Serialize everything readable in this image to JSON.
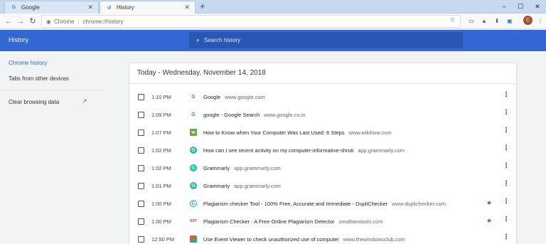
{
  "tabs": [
    {
      "title": "Google",
      "favicon": "google-icon",
      "active": false
    },
    {
      "title": "History",
      "favicon": "history-icon",
      "active": true
    }
  ],
  "toolbar": {
    "site_label": "Chrome",
    "url": "chrome://history"
  },
  "history_header": {
    "title": "History",
    "search_placeholder": "Search history"
  },
  "sidebar": {
    "items": [
      {
        "label": "Chrome history",
        "active": true
      },
      {
        "label": "Tabs from other devices",
        "active": false
      },
      {
        "label": "Clear browsing data",
        "active": false
      }
    ]
  },
  "main": {
    "date_heading": "Today - Wednesday, November 14, 2018",
    "rows": [
      {
        "time": "1:10 PM",
        "title": "Google",
        "domain": "www.google.com",
        "favicon": "google-icon",
        "bookmarked": false
      },
      {
        "time": "1:09 PM",
        "title": "google - Google Search",
        "domain": "www.google.co.in",
        "favicon": "google-icon",
        "bookmarked": false
      },
      {
        "time": "1:07 PM",
        "title": "How to Know when Your Computer Was Last Used: 6 Steps",
        "domain": "www.wikihow.com",
        "favicon": "wikihow-icon",
        "bookmarked": false
      },
      {
        "time": "1:02 PM",
        "title": "How can I see recent activity on my computer-informative-shruti",
        "domain": "app.grammarly.com",
        "favicon": "grammarly-icon",
        "bookmarked": false
      },
      {
        "time": "1:02 PM",
        "title": "Grammarly",
        "domain": "app.grammarly.com",
        "favicon": "grammarly-icon",
        "bookmarked": false
      },
      {
        "time": "1:01 PM",
        "title": "Grammarly",
        "domain": "app.grammarly.com",
        "favicon": "grammarly-icon",
        "bookmarked": false
      },
      {
        "time": "1:00 PM",
        "title": "Plagiarism checker Tool - 100% Free, Accurate and Immediate - DupliChecker",
        "domain": "www.duplichecker.com",
        "favicon": "duplichecker-icon",
        "bookmarked": true
      },
      {
        "time": "1:00 PM",
        "title": "Plagiarism Checker - A Free Online Plagiarism Detector",
        "domain": "smallseotools.com",
        "favicon": "smallseotools-icon",
        "bookmarked": true
      },
      {
        "time": "12:50 PM",
        "title": "Use Event Viewer to check unauthorized use of computer",
        "domain": "www.thewindowsclub.com",
        "favicon": "thewindowsclub-icon",
        "bookmarked": false
      }
    ]
  },
  "colors": {
    "header_blue": "#3367d6",
    "active_link": "#3367d6",
    "bookmark_star": "#3367d6"
  }
}
